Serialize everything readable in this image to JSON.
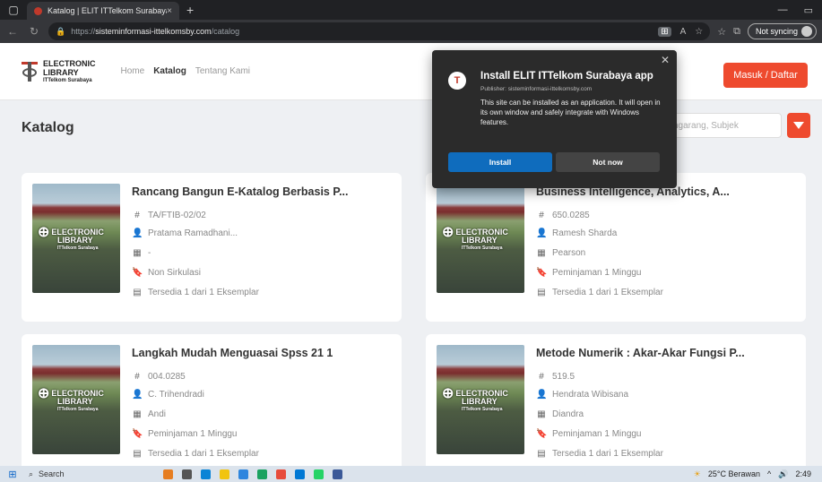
{
  "browser": {
    "tab_title": "Katalog | ELIT ITTelkom Surabaya",
    "tab_close": "×",
    "new_tab": "+",
    "url_prefix": "https://",
    "url_host": "sisteminformasi-ittelkomsby.com",
    "url_path": "/catalog",
    "sync_label": "Not syncing"
  },
  "header": {
    "logo_line1": "ELECTRONIC",
    "logo_line2": "LIBRARY",
    "logo_line3": "ITTelkom Surabaya",
    "nav": [
      "Home",
      "Katalog",
      "Tentang Kami"
    ],
    "login_label": "Masuk / Daftar"
  },
  "page": {
    "title": "Katalog",
    "search_value": "ngarang, Subjek"
  },
  "thumb_logo": {
    "line1": "ELECTRONIC",
    "line2": "LIBRARY",
    "line3": "ITTelkom Surabaya"
  },
  "cards": [
    {
      "title": "Rancang Bangun E-Katalog Berbasis P...",
      "code": "TA/FTIB-02/02",
      "author": "Pratama Ramadhani...",
      "publisher": "-",
      "loan": "Non Sirkulasi",
      "availability": "Tersedia 1 dari 1 Eksemplar"
    },
    {
      "title": "Business Intelligence, Analytics, A...",
      "code": "650.0285",
      "author": "Ramesh Sharda",
      "publisher": "Pearson",
      "loan": "Peminjaman 1 Minggu",
      "availability": "Tersedia 1 dari 1 Eksemplar"
    },
    {
      "title": "Langkah Mudah Menguasai Spss 21 1",
      "code": "004.0285",
      "author": "C. Trihendradi",
      "publisher": "Andi",
      "loan": "Peminjaman 1 Minggu",
      "availability": "Tersedia 1 dari 1 Eksemplar"
    },
    {
      "title": "Metode Numerik : Akar-Akar Fungsi P...",
      "code": "519.5",
      "author": "Hendrata Wibisana",
      "publisher": "Diandra",
      "loan": "Peminjaman 1 Minggu",
      "availability": "Tersedia 1 dari 1 Eksemplar"
    }
  ],
  "install_popup": {
    "title": "Install ELIT ITTelkom Surabaya app",
    "publisher": "Publisher: sisteminformasi-ittelkomsby.com",
    "description": "This site can be installed as an application. It will open in its own window and safely integrate with Windows features.",
    "install_label": "Install",
    "not_now_label": "Not now"
  },
  "taskbar": {
    "search_label": "Search",
    "weather": "25°C Berawan",
    "time": "2:49"
  },
  "colors": {
    "accent": "#ee4a2e",
    "install_blue": "#0f6cbd",
    "popup_bg": "#2b2b2b"
  }
}
